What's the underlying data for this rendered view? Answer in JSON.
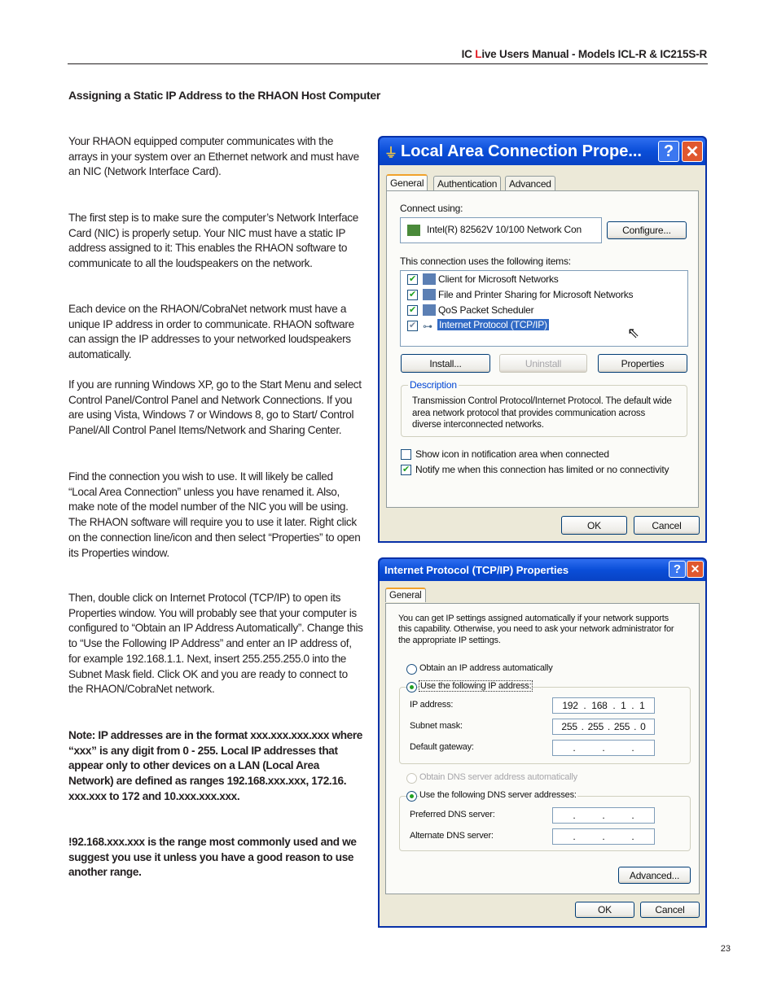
{
  "header": {
    "prefix": "IC ",
    "live_red": "L",
    "suffix": "ive Users Manual - Models  ICL-R & IC215S-R"
  },
  "section_title": "Assigning a Static IP Address to the RHAON Host Computer",
  "paragraphs": [
    "Your  RHAON equipped computer communicates with the arrays in your system over an Ethernet network and must have an NIC (Network Interface Card).",
    "The first step is to make sure the computer’s Network Interface Card (NIC) is properly setup. Your NIC must have a static IP address assigned to it: This enables the RHAON software to communicate to all the loudspeakers on the network.",
    "Each device on the RHAON/CobraNet network must have a unique IP address in order to communicate. RHAON software can assign the IP addresses to your networked loudspeakers automatically.",
    "If you are running Windows XP, go to the Start Menu and select Control Panel/Control Panel and Network Connections. If you are using Vista, Windows 7 or Windows 8, go to Start/ Control Panel/All Control Panel Items/Network and Sharing Center.",
    "Find the connection you wish to use.  It will likely be called “Local Area Connection” unless you have renamed it.  Also, make note of the model number of the NIC you will be using. The RHAON software will require you to use it later. Right click on the connection line/icon and then select “Properties” to open its Properties window.",
    "Then, double click on Internet Protocol (TCP/IP) to open its Properties window.  You will probably see that your computer is configured to “Obtain an IP Address Automatically”.  Change this to “Use the Following IP Address” and enter an IP address of, for example 192.168.1.1. Next, insert 255.255.255.0 into the Subnet Mask field.  Click OK and you are ready to connect to the RHAON/CobraNet network."
  ],
  "notes": [
    "Note: IP addresses are in the format xxx.xxx.xxx.xxx where “xxx” is any digit from 0 - 255.  Local  IP addresses that appear only to other devices on a LAN (Local Area Network) are defined as ranges 192.168.xxx.xxx, 172.16. xxx.xxx to 172 and 10.xxx.xxx.xxx.",
    "!92.168.xxx.xxx is the range most commonly used and we suggest you use it unless you have a good reason to use another range."
  ],
  "page_number": "23",
  "dialog1": {
    "title": "Local Area Connection Prope...",
    "help": "?",
    "close": "✕",
    "tabs": [
      "General",
      "Authentication",
      "Advanced"
    ],
    "connect_using_label": "Connect using:",
    "adapter": "Intel(R) 82562V 10/100 Network Con",
    "configure": "Configure...",
    "items_label": "This connection uses the following items:",
    "items": [
      {
        "label": "Client for Microsoft Networks",
        "checked": true
      },
      {
        "label": "File and Printer Sharing for Microsoft Networks",
        "checked": true
      },
      {
        "label": "QoS Packet Scheduler",
        "checked": true
      },
      {
        "label": "Internet Protocol (TCP/IP)",
        "checked": true,
        "selected": true
      }
    ],
    "install": "Install...",
    "uninstall": "Uninstall",
    "properties": "Properties",
    "description_label": "Description",
    "description": "Transmission Control Protocol/Internet Protocol. The default wide area network protocol that provides communication across diverse interconnected networks.",
    "show_icon": {
      "label": "Show icon in notification area when connected",
      "checked": false
    },
    "notify": {
      "label": "Notify me when this connection has limited or no connectivity",
      "checked": true
    },
    "ok": "OK",
    "cancel": "Cancel"
  },
  "dialog2": {
    "title": "Internet Protocol (TCP/IP) Properties",
    "help": "?",
    "close": "✕",
    "tab": "General",
    "intro": "You can get IP settings assigned automatically if your network supports this capability. Otherwise, you need to ask your network administrator for the appropriate IP settings.",
    "obtain_ip": "Obtain an IP address automatically",
    "use_ip": "Use the following IP address:",
    "ip_label": "IP address:",
    "ip": [
      "192",
      "168",
      "1",
      "1"
    ],
    "subnet_label": "Subnet mask:",
    "subnet": [
      "255",
      "255",
      "255",
      "0"
    ],
    "gateway_label": "Default gateway:",
    "obtain_dns": "Obtain DNS server address automatically",
    "use_dns": "Use the following DNS server addresses:",
    "preferred_label": "Preferred DNS server:",
    "alternate_label": "Alternate DNS server:",
    "advanced": "Advanced...",
    "ok": "OK",
    "cancel": "Cancel"
  },
  "colors": {
    "accent_red": "#e31b23",
    "xp_titlebar": "#0a4ed8",
    "xp_face": "#ece9d8",
    "selection": "#316ac5"
  }
}
